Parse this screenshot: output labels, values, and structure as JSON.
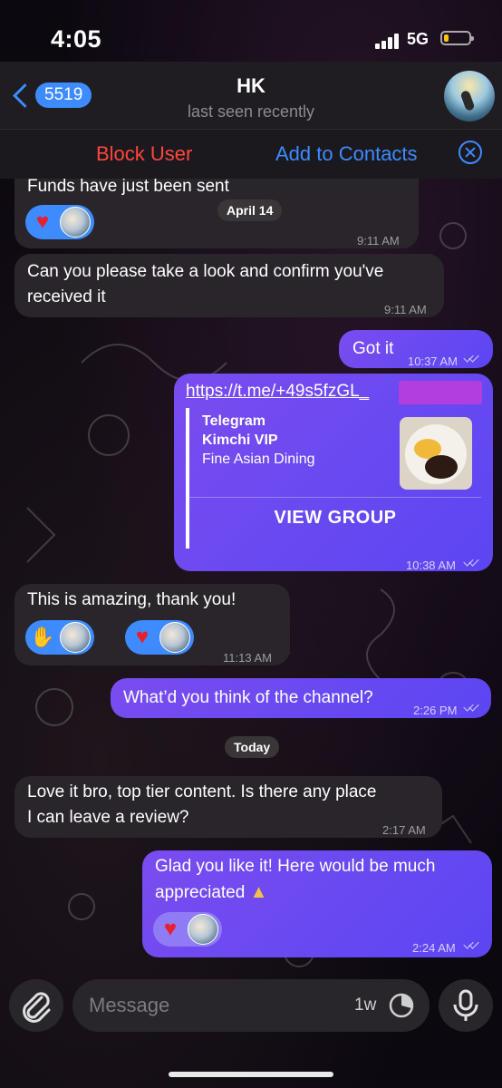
{
  "status_bar": {
    "time": "4:05",
    "network": "5G"
  },
  "header": {
    "back_count": "5519",
    "contact_name": "HK",
    "last_seen": "last seen recently"
  },
  "action_bar": {
    "block_label": "Block User",
    "add_label": "Add to Contacts"
  },
  "messages": [
    {
      "text": "Funds have just been sent",
      "time": "9:11 AM"
    },
    {
      "text_line1": "Can you please take a look and confirm you've",
      "text_line2": "received it",
      "time": "9:11 AM"
    },
    {
      "text": "Got it",
      "time": "10:37 AM"
    },
    {
      "link": "https://t.me/+49s5fzGL_",
      "preview_site": "Telegram",
      "preview_title": "Kimchi VIP",
      "preview_desc": "Fine Asian Dining",
      "preview_button": "VIEW GROUP",
      "time": "10:38 AM"
    },
    {
      "text": "This is amazing, thank you!",
      "time": "11:13 AM"
    },
    {
      "text": "What’d you think of the channel?",
      "time": "2:26 PM"
    },
    {
      "text_line1": "Love it bro, top tier content. Is there any place",
      "text_line2": "I can leave a review?",
      "time": "2:17 AM"
    },
    {
      "text_line1": "Glad you like it! Here would be much",
      "text_line2": "appreciated",
      "time": "2:24 AM"
    }
  ],
  "date_separators": {
    "first": "April 14",
    "second": "Today"
  },
  "composer": {
    "placeholder": "Message",
    "timer": "1w"
  },
  "colors": {
    "accent": "#3d8bff",
    "danger": "#ff453a",
    "outgoing": "#7a4cf0",
    "incoming": "#29252b"
  }
}
